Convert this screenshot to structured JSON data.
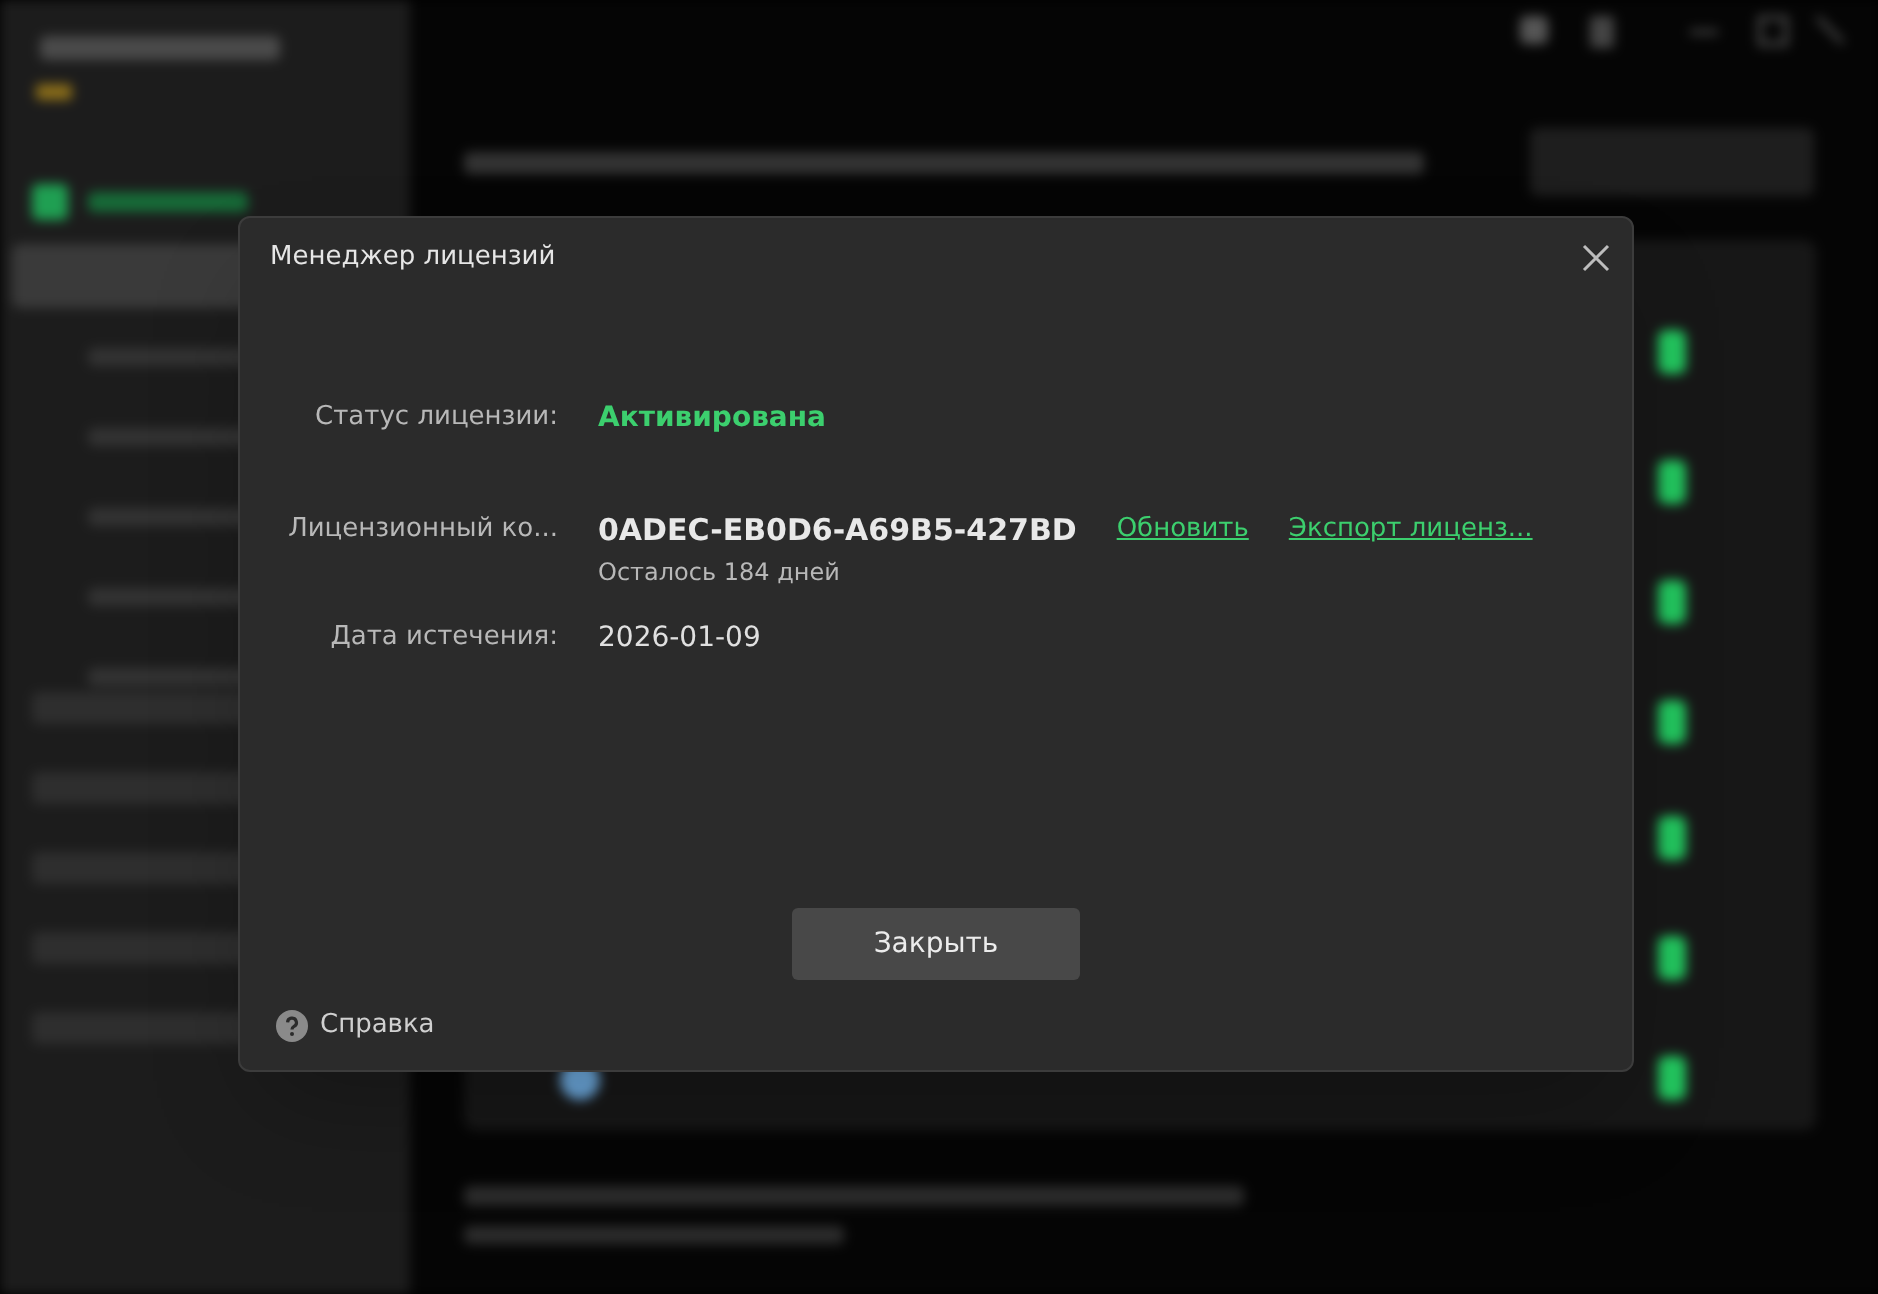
{
  "dialog": {
    "title": "Менеджер лицензий",
    "rows": [
      {
        "kind": "status",
        "label": "Статус лицензии:",
        "value": "Активирована"
      },
      {
        "kind": "key",
        "label": "Лицензионный ко...",
        "value": "0ADEC-EB0D6-A69B5-427BD",
        "note": "Осталось 184 дней",
        "links": [
          "Обновить",
          "Экспорт лиценз..."
        ]
      },
      {
        "kind": "plain",
        "label": "Дата истечения:",
        "value": "2026-01-09"
      }
    ],
    "close_button": "Закрыть",
    "help_link": "Справка"
  }
}
